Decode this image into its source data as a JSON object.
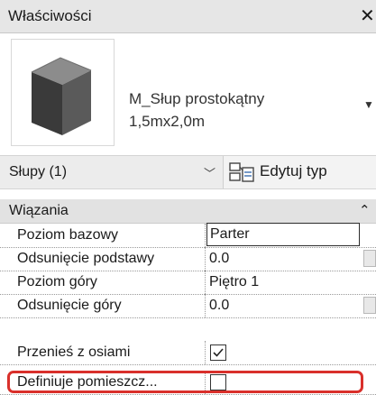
{
  "window": {
    "title": "Właściwości",
    "close_icon": "close-icon"
  },
  "type_preview": {
    "thumbnail_icon": "rectangular-column-3d-icon",
    "type_name": "M_Słup prostokątny",
    "type_size": "1,5mx2,0m",
    "dropdown_icon": "chevron-down-icon"
  },
  "selector": {
    "category": "Słupy (1)",
    "chevron_icon": "chevron-down-icon",
    "edit_type_label": "Edytuj typ",
    "edit_type_icon": "edit-type-icon"
  },
  "group": {
    "title": "Wiązania",
    "collapse_icon": "double-chevron-up-icon"
  },
  "properties": [
    {
      "label": "Poziom bazowy",
      "value": "Parter"
    },
    {
      "label": "Odsunięcie podstawy",
      "value": "0.0"
    },
    {
      "label": "Poziom góry",
      "value": "Piętro 1"
    },
    {
      "label": "Odsunięcie góry",
      "value": "0.0"
    },
    {
      "label": "Przenieś z osiami",
      "checked": true
    },
    {
      "label": "Definiuje pomieszcz...",
      "checked": false
    }
  ],
  "highlight_color": "#d9302b"
}
